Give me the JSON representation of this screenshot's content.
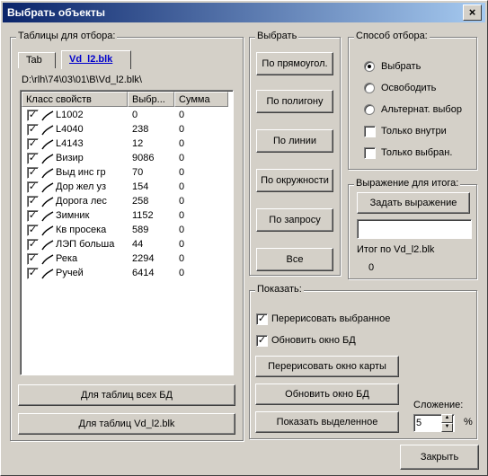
{
  "window": {
    "title": "Выбрать объекты",
    "close": "×"
  },
  "tables_group": {
    "legend": "Таблицы для отбора:",
    "tabs": [
      "Tab",
      "Vd_l2.blk"
    ],
    "path": "D:\\rlh\\74\\03\\01\\B\\Vd_l2.blk\\",
    "columns": [
      "Класс свойств",
      "Выбр...",
      "Сумма"
    ],
    "rows": [
      {
        "name": "L1002",
        "selected": "0",
        "sum": "0",
        "checked": true
      },
      {
        "name": "L4040",
        "selected": "238",
        "sum": "0",
        "checked": true
      },
      {
        "name": "L4143",
        "selected": "12",
        "sum": "0",
        "checked": true
      },
      {
        "name": "Визир",
        "selected": "9086",
        "sum": "0",
        "checked": true
      },
      {
        "name": "Выд инс гр",
        "selected": "70",
        "sum": "0",
        "checked": true
      },
      {
        "name": "Дор жел уз",
        "selected": "154",
        "sum": "0",
        "checked": true
      },
      {
        "name": "Дорога лес",
        "selected": "258",
        "sum": "0",
        "checked": true
      },
      {
        "name": "Зимник",
        "selected": "1152",
        "sum": "0",
        "checked": true
      },
      {
        "name": "Кв просека",
        "selected": "589",
        "sum": "0",
        "checked": true
      },
      {
        "name": "ЛЭП больша",
        "selected": "44",
        "sum": "0",
        "checked": true
      },
      {
        "name": "Река",
        "selected": "2294",
        "sum": "0",
        "checked": true
      },
      {
        "name": "Ручей",
        "selected": "6414",
        "sum": "0",
        "checked": true
      }
    ],
    "btn_all_db": "Для таблиц всех БД",
    "btn_this_db": "Для таблиц Vd_l2.blk"
  },
  "select_group": {
    "legend": "Выбрать",
    "buttons": [
      "По прямоугол.",
      "По полигону",
      "По линии",
      "По окружности",
      "По запросу",
      "Все"
    ]
  },
  "method_group": {
    "legend": "Способ отбора:",
    "radios": [
      "Выбрать",
      "Освободить",
      "Альтернат. выбор"
    ],
    "selected_index": 0,
    "checks": [
      {
        "label": "Только внутри",
        "checked": false
      },
      {
        "label": "Только выбран.",
        "checked": false
      }
    ]
  },
  "expr_group": {
    "legend": "Выражение для итога:",
    "button": "Задать выражение",
    "input_value": "",
    "total_label": "Итог по Vd_l2.blk",
    "total_value": "0"
  },
  "show_group": {
    "legend": "Показать:",
    "checks": [
      {
        "label": "Перерисовать выбранное",
        "checked": true
      },
      {
        "label": "Обновить окно БД",
        "checked": true
      }
    ],
    "buttons": [
      "Перерисовать окно карты",
      "Обновить окно БД",
      "Показать выделенное"
    ],
    "addition_label": "Сложение:",
    "addition_value": "5",
    "percent": "%"
  },
  "close_button": "Закрыть"
}
